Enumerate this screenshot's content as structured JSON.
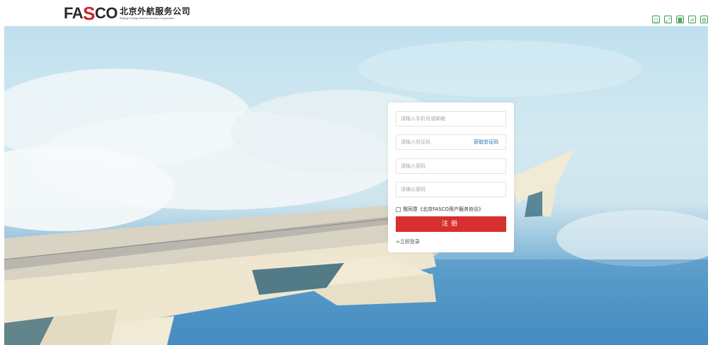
{
  "brand": {
    "logo_letters_1": "FA",
    "logo_letters_s": "S",
    "logo_letters_2": "CO",
    "name_cn": "北京外航服务公司",
    "name_en": "Beijing Foreign Airlines Service Corporation"
  },
  "toolbar": {
    "icons": [
      "window-icon",
      "expand-icon",
      "save-icon",
      "share-icon",
      "settings-icon"
    ],
    "glyphs": [
      "◻",
      "⤢",
      "◙",
      "⇗",
      "⚙"
    ],
    "color": "#3aa050"
  },
  "form": {
    "phone_placeholder": "请输入手机号或邮箱",
    "code_placeholder": "请输入验证码",
    "get_code_label": "获取验证码",
    "password_placeholder": "请输入密码",
    "confirm_placeholder": "请确认密码",
    "agree_prefix": "我同意",
    "agree_link": "《北京FASCO用户服务协议》",
    "submit_label": "注册",
    "login_link": "≈立即登录"
  },
  "colors": {
    "accent": "#d7302f",
    "link": "#1d6fb8"
  }
}
